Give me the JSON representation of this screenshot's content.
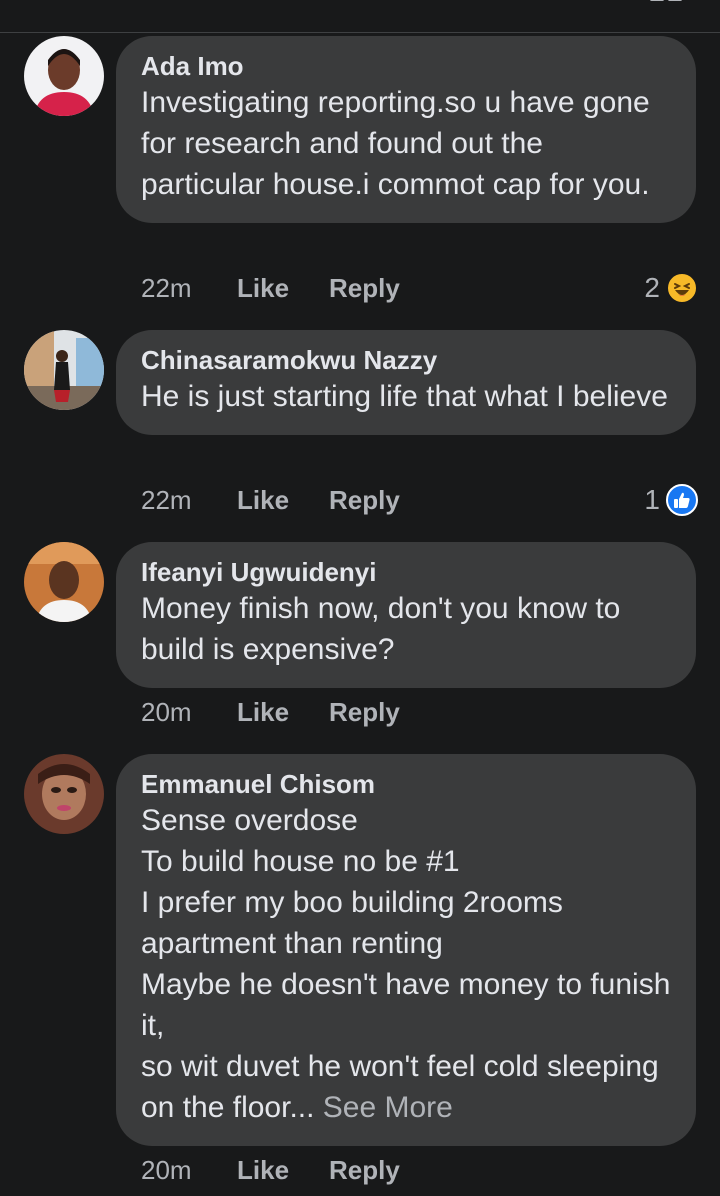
{
  "comments": [
    {
      "author": "Ada Imo",
      "text": "Investigating reporting.so u have gone for research and found out the particular house.i commot cap for you.",
      "time": "22m",
      "like_label": "Like",
      "reply_label": "Reply",
      "reaction_count": "2",
      "reaction_icon": "laugh-emoji-icon"
    },
    {
      "author": "Chinasaramokwu  Nazzy",
      "text": "He is just starting life that what I believe",
      "time": "22m",
      "like_label": "Like",
      "reply_label": "Reply",
      "reaction_count": "1",
      "reaction_icon": "like-thumb-icon"
    },
    {
      "author": "Ifeanyi Ugwuidenyi",
      "text": "Money finish now, don't you know to build is expensive?",
      "time": "20m",
      "like_label": "Like",
      "reply_label": "Reply"
    },
    {
      "author": "Emmanuel Chisom",
      "text": "Sense overdose\nTo build house no be #1\nI prefer my boo building 2rooms apartment than renting\nMaybe he doesn't have money to funish it,\nso wit duvet he won't feel cold sleeping on the floor...",
      "see_more": " See More",
      "time": "20m",
      "like_label": "Like",
      "reply_label": "Reply"
    }
  ],
  "colors": {
    "background": "#18191a",
    "bubble": "#3a3b3c",
    "text": "#e4e6eb",
    "secondary_text": "#b0b3b8",
    "like_blue": "#1877f2",
    "laugh_yellow": "#f7b928"
  }
}
